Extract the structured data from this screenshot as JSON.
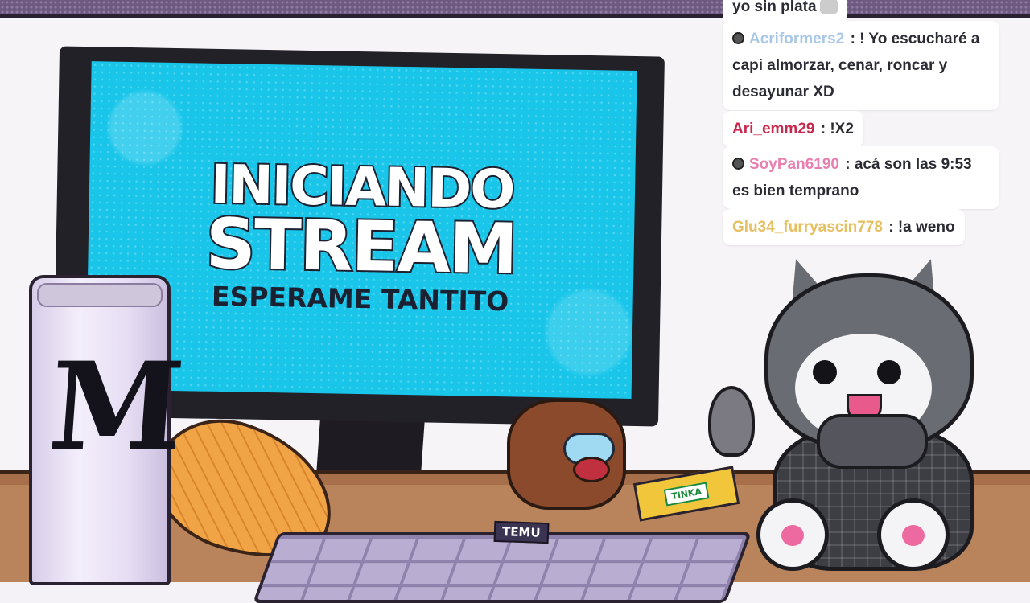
{
  "screen": {
    "title_line1": "INICIANDO",
    "title_line2": "STREAM",
    "subtitle": "ESPERAME TANTITO"
  },
  "props": {
    "keyboard_tag": "TEMU",
    "lottery_card": "TINKA"
  },
  "chat": {
    "messages": [
      {
        "user": "",
        "text": "yo sin plata",
        "color": "#2b2b33",
        "badge": false
      },
      {
        "user": "Acriformers2",
        "text": ": ! Yo escucharé a capi almorzar, cenar, roncar y desayunar XD",
        "color": "#a9c8e6",
        "badge": true
      },
      {
        "user": "Ari_emm29",
        "text": ": !X2",
        "color": "#c8284e",
        "badge": false
      },
      {
        "user": "SoyPan6190",
        "text": ": acá son las 9:53 es bien temprano",
        "color": "#e77fb0",
        "badge": true
      },
      {
        "user": "Glu34_furryascin778",
        "text": ": !a weno",
        "color": "#e6c060",
        "badge": false
      }
    ]
  },
  "colors": {
    "screen": "#19c6ea",
    "frame": "#6e5a80",
    "desk": "#b9845c"
  }
}
